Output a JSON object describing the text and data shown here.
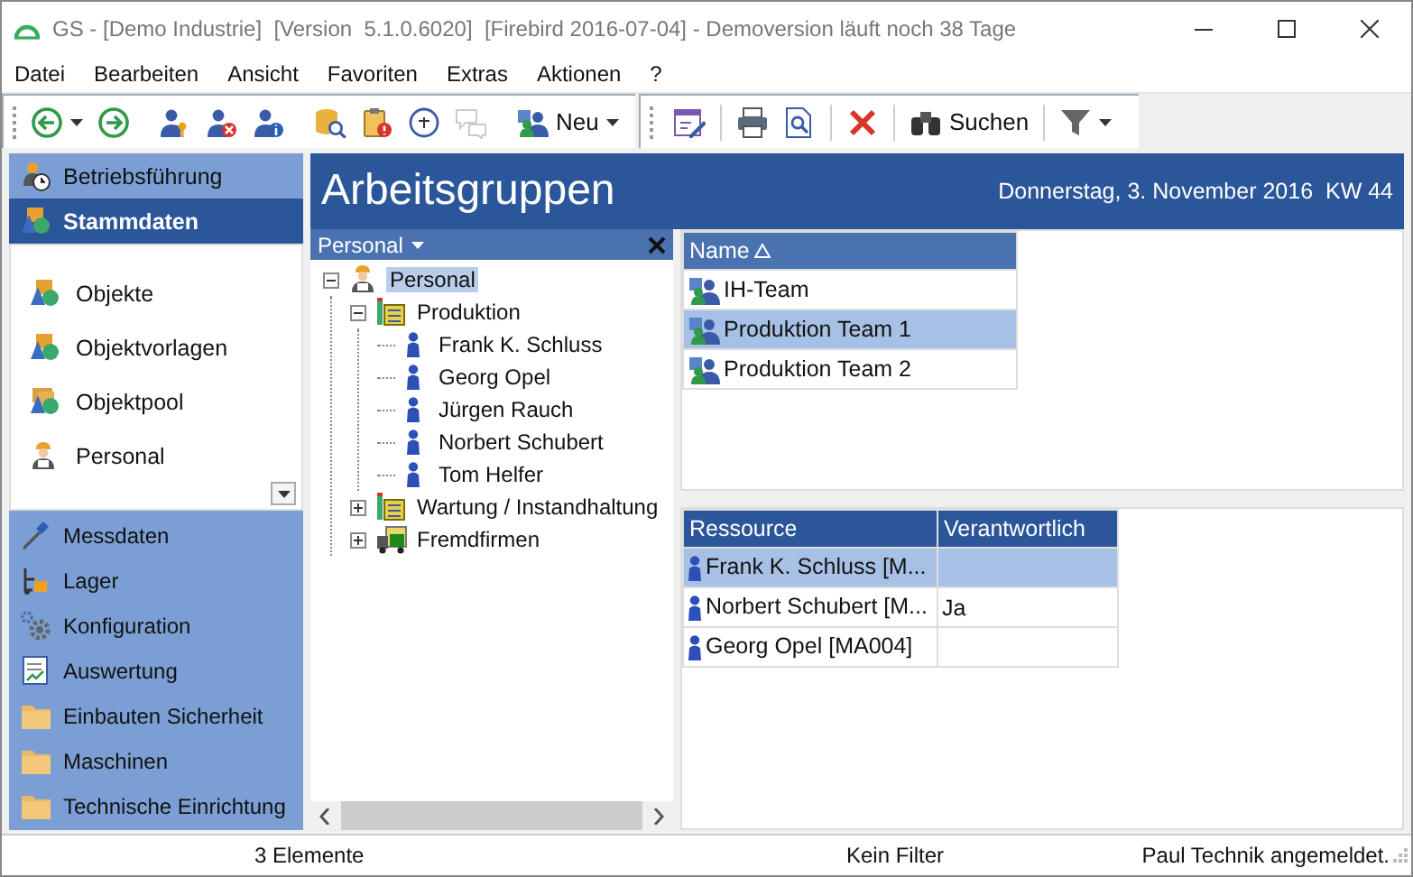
{
  "window": {
    "title": "GS - [Demo Industrie]  [Version  5.1.0.6020]  [Firebird 2016-07-04] - Demoversion läuft noch 38 Tage"
  },
  "menu": [
    "Datei",
    "Bearbeiten",
    "Ansicht",
    "Favoriten",
    "Extras",
    "Aktionen",
    "?"
  ],
  "toolbars": [
    [
      {
        "kind": "back",
        "dropdown": true,
        "disabled": false
      },
      {
        "kind": "forward",
        "dropdown": false,
        "disabled": false
      },
      {
        "kind": "sep"
      },
      {
        "kind": "user-key",
        "dropdown": false,
        "disabled": false
      },
      {
        "kind": "user-remove",
        "dropdown": false,
        "disabled": false
      },
      {
        "kind": "user-info",
        "dropdown": false,
        "disabled": false
      },
      {
        "kind": "sep"
      },
      {
        "kind": "db-search",
        "dropdown": false,
        "disabled": false
      },
      {
        "kind": "clipboard-alert",
        "dropdown": false,
        "disabled": false
      },
      {
        "kind": "phone24",
        "dropdown": false,
        "disabled": false
      },
      {
        "kind": "chat",
        "dropdown": false,
        "disabled": true
      },
      {
        "kind": "sep"
      },
      {
        "kind": "group",
        "label": "Neu",
        "dropdown": true,
        "disabled": false
      }
    ],
    [
      {
        "kind": "form-edit",
        "dropdown": false,
        "disabled": false
      },
      {
        "kind": "sep"
      },
      {
        "kind": "printer",
        "dropdown": false,
        "disabled": false
      },
      {
        "kind": "preview",
        "dropdown": false,
        "disabled": false
      },
      {
        "kind": "sep"
      },
      {
        "kind": "delete",
        "dropdown": false,
        "disabled": false
      },
      {
        "kind": "sep"
      },
      {
        "kind": "binoculars",
        "label": "Suchen",
        "dropdown": false,
        "disabled": false
      },
      {
        "kind": "sep"
      },
      {
        "kind": "filter",
        "dropdown": true,
        "disabled": false
      }
    ]
  ],
  "sidebar": {
    "sections": [
      {
        "label": "Betriebsführung",
        "kind": "operations",
        "selected": false
      },
      {
        "label": "Stammdaten",
        "kind": "master",
        "selected": true
      }
    ],
    "items": [
      {
        "label": "Objekte",
        "kind": "objects"
      },
      {
        "label": "Objektvorlagen",
        "kind": "objects"
      },
      {
        "label": "Objektpool",
        "kind": "pool"
      },
      {
        "label": "Personal",
        "kind": "personnel"
      }
    ],
    "more_sections": [
      {
        "label": "Messdaten",
        "kind": "probe"
      },
      {
        "label": "Lager",
        "kind": "store"
      },
      {
        "label": "Konfiguration",
        "kind": "gears"
      },
      {
        "label": "Auswertung",
        "kind": "report"
      },
      {
        "label": "Einbauten Sicherheit",
        "kind": "folder"
      },
      {
        "label": "Maschinen",
        "kind": "folder"
      },
      {
        "label": "Technische Einrichtung",
        "kind": "folder"
      }
    ]
  },
  "header": {
    "title": "Arbeitsgruppen",
    "date": "Donnerstag, 3. November 2016  KW 44"
  },
  "tree": {
    "title": "Personal",
    "nodes": [
      {
        "label": "Personal",
        "kind": "personnel",
        "expanded": true,
        "selected": true,
        "children": [
          {
            "label": "Produktion",
            "kind": "org",
            "expanded": true,
            "selected": false,
            "children": [
              {
                "label": "Frank K. Schluss",
                "kind": "person",
                "selected": false
              },
              {
                "label": "Georg Opel",
                "kind": "person",
                "selected": false
              },
              {
                "label": "Jürgen Rauch",
                "kind": "person",
                "selected": false
              },
              {
                "label": "Norbert Schubert",
                "kind": "person",
                "selected": false
              },
              {
                "label": "Tom Helfer",
                "kind": "person",
                "selected": false
              }
            ]
          },
          {
            "label": "Wartung / Instandhaltung",
            "kind": "org",
            "expanded": false,
            "selected": false
          },
          {
            "label": "Fremdfirmen",
            "kind": "contractor",
            "expanded": false,
            "selected": false
          }
        ]
      }
    ]
  },
  "groups_table": {
    "columns": [
      {
        "label": "Name",
        "sorted": true
      }
    ],
    "rows": [
      {
        "name": "IH-Team",
        "selected": false
      },
      {
        "name": "Produktion Team 1",
        "selected": true
      },
      {
        "name": "Produktion Team 2",
        "selected": false
      }
    ]
  },
  "resources_table": {
    "columns": [
      "Ressource",
      "Verantwortlich"
    ],
    "rows": [
      {
        "resource": "Frank K. Schluss [M...",
        "selected": true
      },
      {
        "resource": "Norbert Schubert [M...",
        "responsible": "Ja",
        "selected": false
      },
      {
        "resource": "Georg Opel [MA004]",
        "selected": false
      }
    ]
  },
  "status_bar": [
    "3 Elemente",
    "Kein Filter",
    "Paul Technik angemeldet."
  ]
}
